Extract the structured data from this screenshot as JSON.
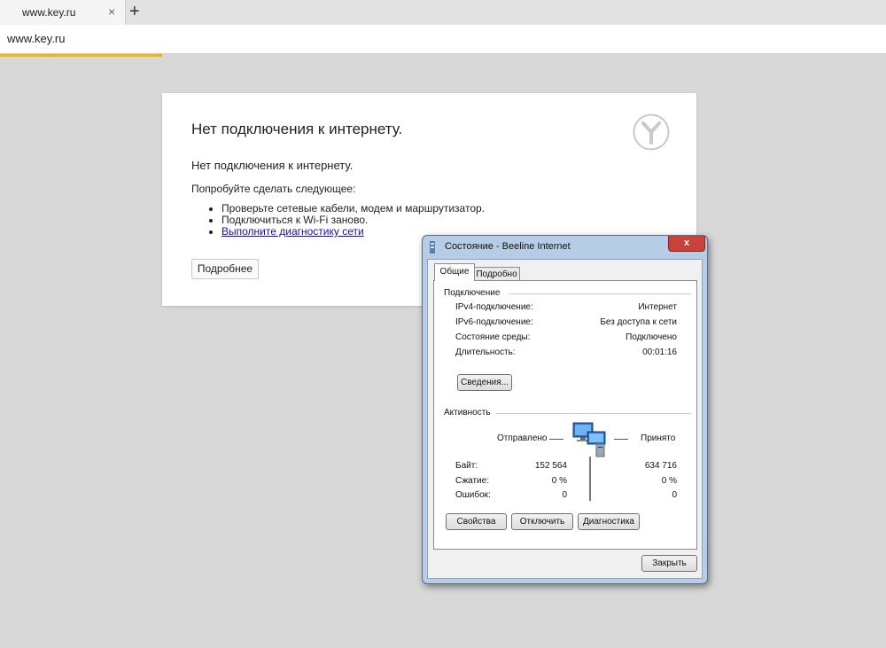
{
  "browser": {
    "tab_title": "www.key.ru",
    "tab_close": "×",
    "new_tab": "+",
    "address": "www.key.ru"
  },
  "error_page": {
    "title": "Нет подключения к интернету.",
    "subtitle": "Нет подключения к интернету.",
    "try_label": "Попробуйте сделать следующее:",
    "suggestions": [
      "Проверьте сетевые кабели, модем и маршрутизатор.",
      "Подключиться к Wi-Fi заново."
    ],
    "diagnostics_link": "Выполните диагностику сети",
    "more_button": "Подробнее"
  },
  "dialog": {
    "title": "Состояние - Beeline Internet",
    "close_glyph": "x",
    "tabs": [
      "Общие",
      "Подробно"
    ],
    "connection_group": "Подключение",
    "connection_rows": [
      {
        "label": "IPv4-подключение:",
        "value": "Интернет"
      },
      {
        "label": "IPv6-подключение:",
        "value": "Без доступа к сети"
      },
      {
        "label": "Состояние среды:",
        "value": "Подключено"
      },
      {
        "label": "Длительность:",
        "value": "00:01:16"
      }
    ],
    "details_button": "Сведения...",
    "activity_group": "Активность",
    "sent_label": "Отправлено",
    "received_label": "Принято",
    "activity_rows": [
      {
        "label": "Байт:",
        "sent": "152 564",
        "received": "634 716"
      },
      {
        "label": "Сжатие:",
        "sent": "0 %",
        "received": "0 %"
      },
      {
        "label": "Ошибок:",
        "sent": "0",
        "received": "0"
      }
    ],
    "properties_button": "Свойства",
    "disconnect_button": "Отключить",
    "diagnostics_button": "Диагностика",
    "close_button": "Закрыть"
  },
  "colors": {
    "progress": "#f5b800",
    "link": "#1a0dab",
    "close_red": "#c8423a"
  }
}
